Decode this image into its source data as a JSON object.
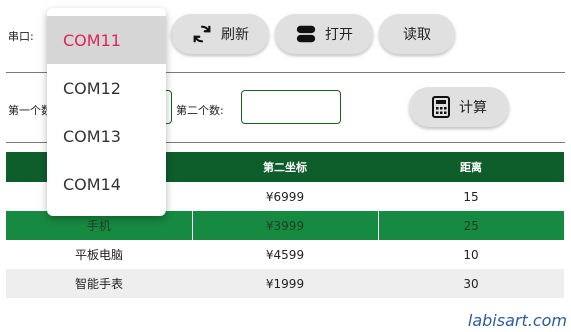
{
  "toolbar": {
    "port_label": "串口:",
    "refresh_label": "刷新",
    "open_label": "打开",
    "read_label": "读取"
  },
  "calc": {
    "first_label": "第一个数",
    "second_label": "第二个数:",
    "first_value": "",
    "second_value": "",
    "calc_label": "计算"
  },
  "table": {
    "headers": [
      "",
      "第二坐标",
      "距离"
    ],
    "rows": [
      [
        "",
        "¥6999",
        "15"
      ],
      [
        "手机",
        "¥3999",
        "25"
      ],
      [
        "平板电脑",
        "¥4599",
        "10"
      ],
      [
        "智能手表",
        "¥1999",
        "30"
      ]
    ]
  },
  "dropdown": {
    "options": [
      "COM11",
      "COM12",
      "COM13",
      "COM14"
    ],
    "selected": "COM11"
  },
  "watermark": "labisart.com",
  "colors": {
    "header_green": "#0d5e2b",
    "highlight_row": "#178a41",
    "selected_option_text": "#e0245e",
    "button_bg": "#e0e0e0"
  }
}
